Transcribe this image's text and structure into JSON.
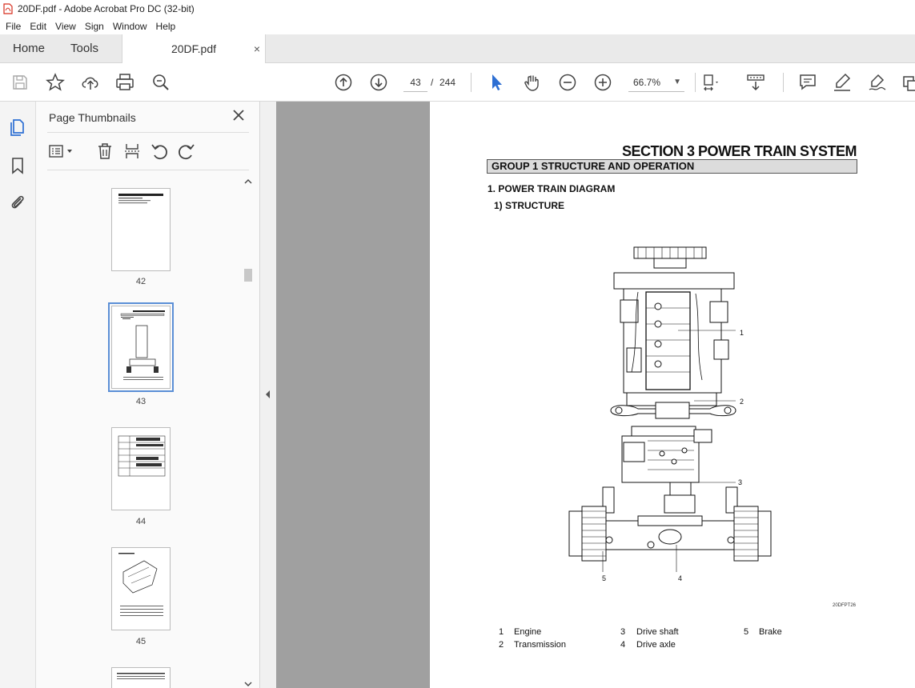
{
  "window": {
    "title": "20DF.pdf - Adobe Acrobat Pro DC (32-bit)"
  },
  "menu": [
    "File",
    "Edit",
    "View",
    "Sign",
    "Window",
    "Help"
  ],
  "tabs": {
    "home": "Home",
    "tools": "Tools",
    "document": "20DF.pdf",
    "close": "×"
  },
  "toolbar": {
    "current_page": "43",
    "page_separator": "/",
    "total_pages": "244",
    "zoom": "66.7%"
  },
  "thumbnails_panel": {
    "title": "Page Thumbnails",
    "pages": [
      {
        "label": "42",
        "selected": false
      },
      {
        "label": "43",
        "selected": true
      },
      {
        "label": "44",
        "selected": false
      },
      {
        "label": "45",
        "selected": false
      }
    ]
  },
  "document_page": {
    "section_title": "SECTION  3  POWER TRAIN SYSTEM",
    "group_title": "GROUP  1  STRUCTURE AND OPERATION",
    "heading_1": "1. POWER TRAIN DIAGRAM",
    "heading_2": "1) STRUCTURE",
    "figure_code": "20DFPT26",
    "callouts": [
      "1",
      "2",
      "3",
      "4",
      "5"
    ],
    "legend": [
      {
        "num": "1",
        "text": "Engine"
      },
      {
        "num": "2",
        "text": "Transmission"
      },
      {
        "num": "3",
        "text": "Drive shaft"
      },
      {
        "num": "4",
        "text": "Drive axle"
      },
      {
        "num": "5",
        "text": "Brake"
      }
    ]
  },
  "colors": {
    "viewer_bg": "#a0a0a0",
    "tab_bar_bg": "#eaeaea",
    "select_accent": "#5b8fd6",
    "pointer_tool": "#2d6fd3",
    "pdf_icon_red": "#d62c1c"
  }
}
